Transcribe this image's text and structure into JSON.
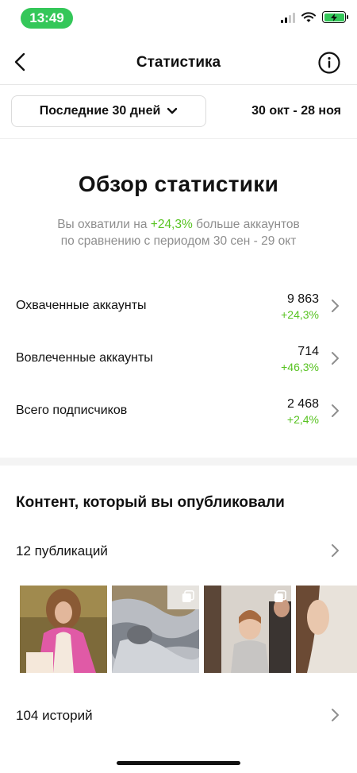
{
  "status_bar": {
    "time": "13:49",
    "battery_color": "#34c759"
  },
  "nav": {
    "title": "Статистика",
    "back_icon": "chevron-left-icon",
    "info_icon": "info-icon"
  },
  "filter": {
    "range_label": "Последние 30 дней",
    "date_range": "30 окт - 28 ноя"
  },
  "overview": {
    "title": "Обзор статистики",
    "subtitle_prefix": "Вы охватили на ",
    "subtitle_highlight": "+24,3%",
    "subtitle_suffix": " больше аккаунтов",
    "subtitle_line2": "по сравнению с периодом 30 сен - 29 окт",
    "accent_color": "#58c322"
  },
  "stats": [
    {
      "label": "Охваченные аккаунты",
      "value": "9 863",
      "delta": "+24,3%"
    },
    {
      "label": "Вовлеченные аккаунты",
      "value": "714",
      "delta": "+46,3%"
    },
    {
      "label": "Всего подписчиков",
      "value": "2 468",
      "delta": "+2,4%"
    }
  ],
  "content": {
    "title": "Контент, который вы опубликовали",
    "posts_label": "12 публикаций",
    "stories_label": "104 историй",
    "thumbnails": [
      {
        "name": "thumb-woman-pink-jacket",
        "multi": false
      },
      {
        "name": "thumb-silver-fabric",
        "multi": true
      },
      {
        "name": "thumb-women-room",
        "multi": true
      },
      {
        "name": "thumb-woman-partial",
        "multi": false
      }
    ]
  }
}
